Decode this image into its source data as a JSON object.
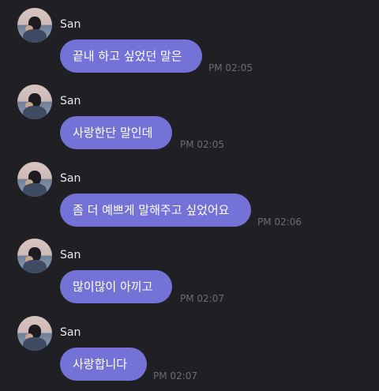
{
  "messages": [
    {
      "sender": "San",
      "text": "끝내 하고 싶었던 말은",
      "time": "PM 02:05"
    },
    {
      "sender": "San",
      "text": "사랑한단 말인데",
      "time": "PM 02:05"
    },
    {
      "sender": "San",
      "text": "좀 더 예쁘게 말해주고 싶었어요",
      "time": "PM 02:06"
    },
    {
      "sender": "San",
      "text": "많이많이 아끼고",
      "time": "PM 02:07"
    },
    {
      "sender": "San",
      "text": "사랑합니다",
      "time": "PM 02:07"
    }
  ],
  "colors": {
    "background": "#1f1f24",
    "bubble": "#7472d6",
    "time": "#6c6c74",
    "sender": "#e8e8ec"
  }
}
